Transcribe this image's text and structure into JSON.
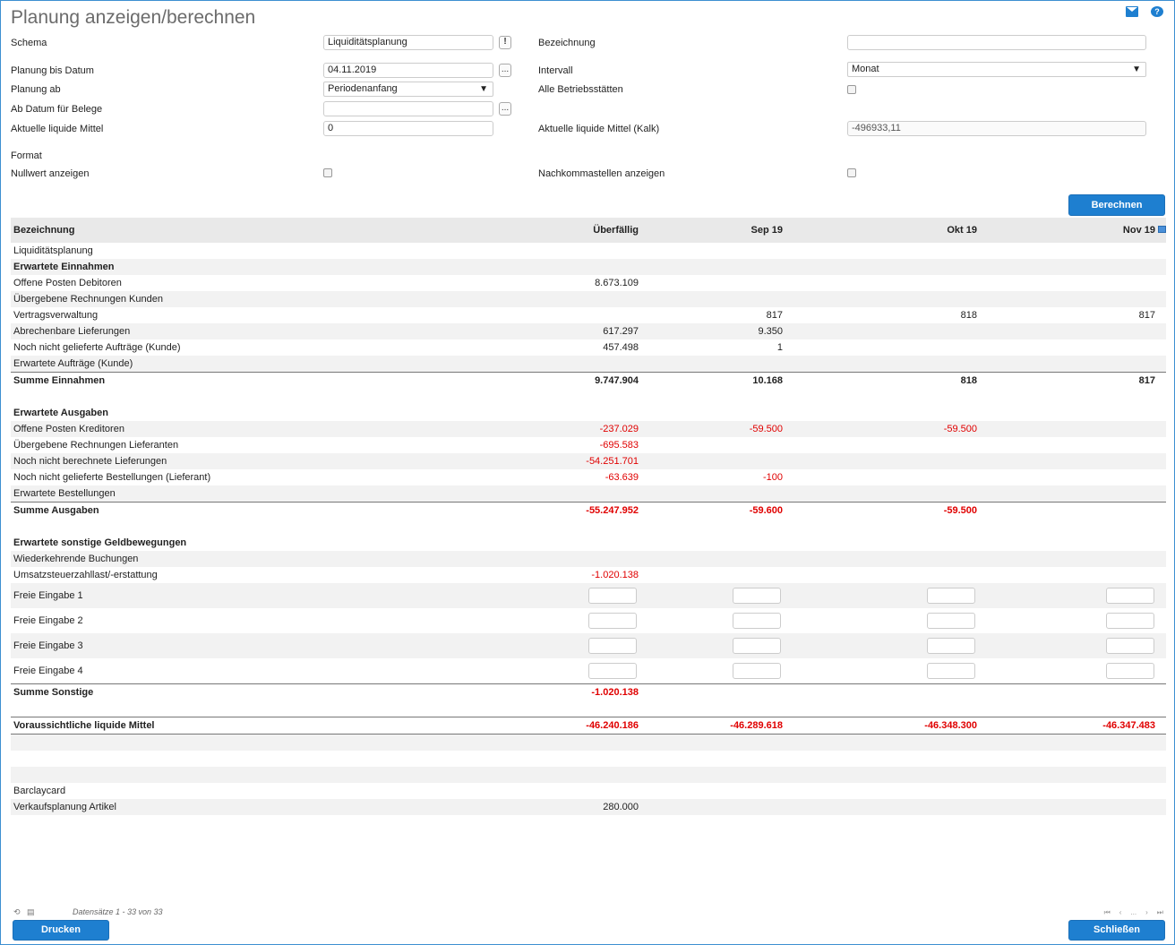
{
  "title": "Planung anzeigen/berechnen",
  "form": {
    "schema_label": "Schema",
    "schema_value": "Liquiditätsplanung",
    "bezeichnung_label": "Bezeichnung",
    "bezeichnung_value": "",
    "planung_bis_label": "Planung bis Datum",
    "planung_bis_value": "04.11.2019",
    "intervall_label": "Intervall",
    "intervall_value": "Monat",
    "planung_ab_label": "Planung ab",
    "planung_ab_value": "Periodenanfang",
    "alle_betriebsstaetten_label": "Alle Betriebsstätten",
    "ab_datum_label": "Ab Datum für Belege",
    "ab_datum_value": "",
    "akt_liquide_label": "Aktuelle liquide Mittel",
    "akt_liquide_value": "0",
    "akt_liquide_kalk_label": "Aktuelle liquide Mittel (Kalk)",
    "akt_liquide_kalk_value": "-496933,11",
    "format_label": "Format",
    "nullwert_label": "Nullwert anzeigen",
    "nachkomma_label": "Nachkommastellen anzeigen",
    "ellipsis": "...",
    "info_glyph": "!"
  },
  "buttons": {
    "berechnen": "Berechnen",
    "drucken": "Drucken",
    "schliessen": "Schließen"
  },
  "table": {
    "headers": [
      "Bezeichnung",
      "Überfällig",
      "Sep 19",
      "Okt 19",
      "Nov 19"
    ],
    "rows": [
      {
        "label": "Liquiditätsplanung",
        "v": [
          "",
          "",
          "",
          ""
        ],
        "style": ""
      },
      {
        "label": "Erwartete Einnahmen",
        "v": [
          "",
          "",
          "",
          ""
        ],
        "style": "bold"
      },
      {
        "label": "Offene Posten Debitoren",
        "v": [
          "8.673.109",
          "",
          "",
          ""
        ],
        "style": ""
      },
      {
        "label": "Übergebene Rechnungen Kunden",
        "v": [
          "",
          "",
          "",
          ""
        ],
        "style": ""
      },
      {
        "label": "Vertragsverwaltung",
        "v": [
          "",
          "817",
          "818",
          "817"
        ],
        "style": ""
      },
      {
        "label": "Abrechenbare Lieferungen",
        "v": [
          "617.297",
          "9.350",
          "",
          ""
        ],
        "style": ""
      },
      {
        "label": "Noch nicht gelieferte Aufträge (Kunde)",
        "v": [
          "457.498",
          "1",
          "",
          ""
        ],
        "style": ""
      },
      {
        "label": "Erwartete Aufträge (Kunde)",
        "v": [
          "",
          "",
          "",
          ""
        ],
        "style": ""
      },
      {
        "label": "Summe Einnahmen",
        "v": [
          "9.747.904",
          "10.168",
          "818",
          "817"
        ],
        "style": "sum"
      },
      {
        "label": "",
        "v": [
          "",
          "",
          "",
          ""
        ],
        "style": ""
      },
      {
        "label": "Erwartete Ausgaben",
        "v": [
          "",
          "",
          "",
          ""
        ],
        "style": "bold"
      },
      {
        "label": "Offene Posten Kreditoren",
        "v": [
          "-237.029",
          "-59.500",
          "-59.500",
          ""
        ],
        "style": ""
      },
      {
        "label": "Übergebene Rechnungen Lieferanten",
        "v": [
          "-695.583",
          "",
          "",
          ""
        ],
        "style": ""
      },
      {
        "label": "Noch nicht berechnete Lieferungen",
        "v": [
          "-54.251.701",
          "",
          "",
          ""
        ],
        "style": ""
      },
      {
        "label": "Noch nicht gelieferte Bestellungen (Lieferant)",
        "v": [
          "-63.639",
          "-100",
          "",
          ""
        ],
        "style": ""
      },
      {
        "label": "Erwartete Bestellungen",
        "v": [
          "",
          "",
          "",
          ""
        ],
        "style": ""
      },
      {
        "label": "Summe Ausgaben",
        "v": [
          "-55.247.952",
          "-59.600",
          "-59.500",
          ""
        ],
        "style": "sum"
      },
      {
        "label": "",
        "v": [
          "",
          "",
          "",
          ""
        ],
        "style": ""
      },
      {
        "label": "Erwartete sonstige Geldbewegungen",
        "v": [
          "",
          "",
          "",
          ""
        ],
        "style": "bold"
      },
      {
        "label": "Wiederkehrende Buchungen",
        "v": [
          "",
          "",
          "",
          ""
        ],
        "style": ""
      },
      {
        "label": "Umsatzsteuerzahllast/-erstattung",
        "v": [
          "-1.020.138",
          "",
          "",
          ""
        ],
        "style": ""
      },
      {
        "label": "Freie Eingabe 1",
        "v": [
          "",
          "",
          "",
          ""
        ],
        "style": "input"
      },
      {
        "label": "Freie Eingabe 2",
        "v": [
          "",
          "",
          "",
          ""
        ],
        "style": "input"
      },
      {
        "label": "Freie Eingabe 3",
        "v": [
          "",
          "",
          "",
          ""
        ],
        "style": "input"
      },
      {
        "label": "Freie Eingabe 4",
        "v": [
          "",
          "",
          "",
          ""
        ],
        "style": "input"
      },
      {
        "label": "Summe Sonstige",
        "v": [
          "-1.020.138",
          "",
          "",
          ""
        ],
        "style": "sum"
      },
      {
        "label": "",
        "v": [
          "",
          "",
          "",
          ""
        ],
        "style": ""
      },
      {
        "label": "Voraussichtliche liquide Mittel",
        "v": [
          "-46.240.186",
          "-46.289.618",
          "-46.348.300",
          "-46.347.483"
        ],
        "style": "total"
      },
      {
        "label": "",
        "v": [
          "",
          "",
          "",
          ""
        ],
        "style": ""
      },
      {
        "label": "",
        "v": [
          "",
          "",
          "",
          ""
        ],
        "style": ""
      },
      {
        "label": "",
        "v": [
          "",
          "",
          "",
          ""
        ],
        "style": ""
      },
      {
        "label": "Barclaycard",
        "v": [
          "",
          "",
          "",
          ""
        ],
        "style": ""
      },
      {
        "label": "Verkaufsplanung Artikel",
        "v": [
          "280.000",
          "",
          "",
          ""
        ],
        "style": ""
      }
    ]
  },
  "footer": {
    "records": "Datensätze 1 - 33 von 33",
    "pager_first": "⏮",
    "pager_prev": "‹",
    "pager_dots": "...",
    "pager_next": "›",
    "pager_last": "⏭"
  },
  "colors": {
    "accent": "#1e7fd0",
    "negative": "#e00000"
  }
}
